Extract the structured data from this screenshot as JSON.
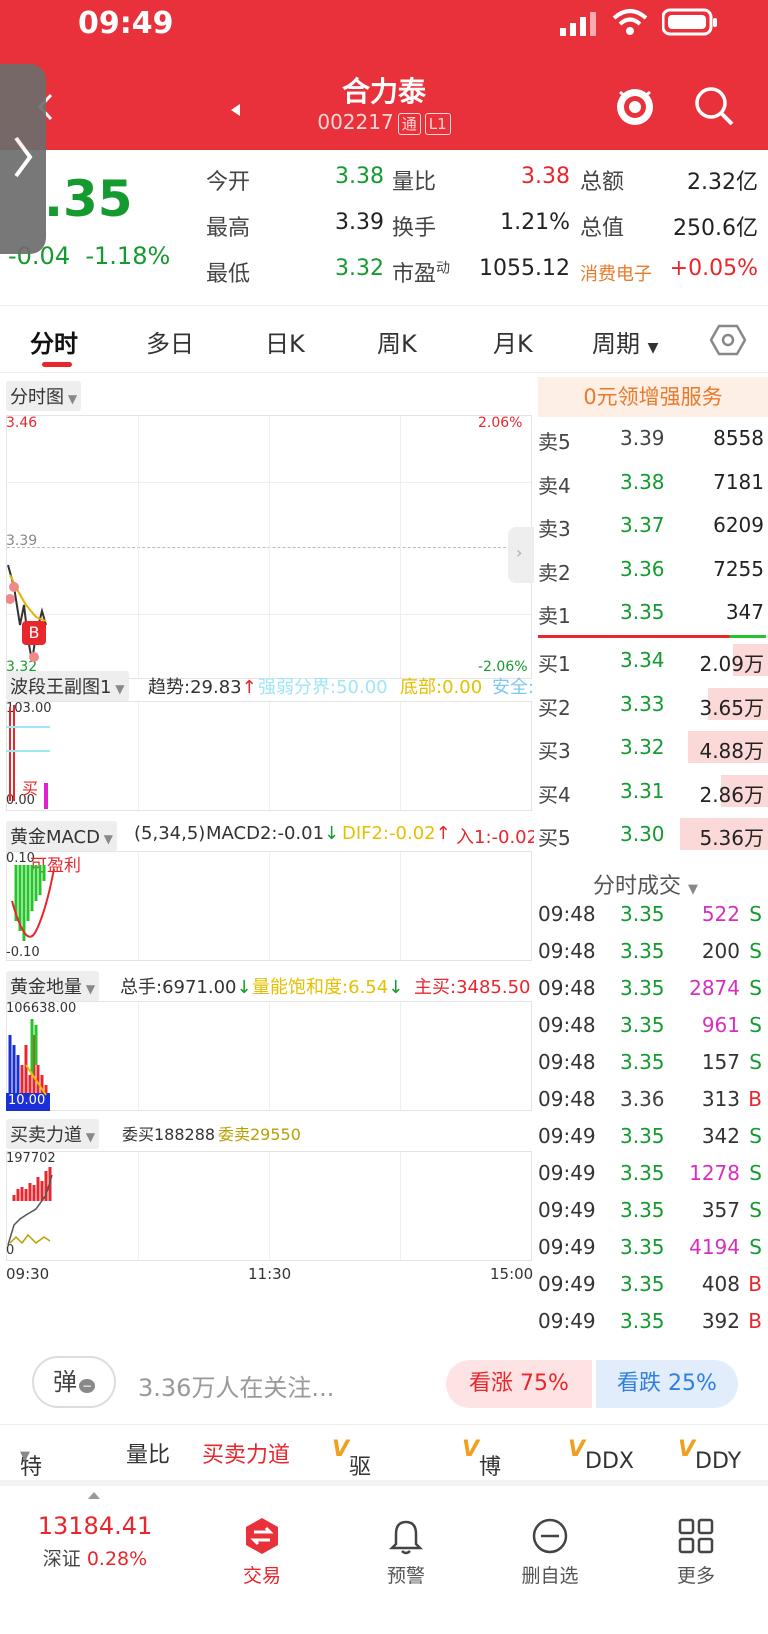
{
  "status": {
    "time": "09:49"
  },
  "header": {
    "name": "合力泰",
    "code": "002217",
    "tag1": "通",
    "tag2": "L1"
  },
  "quote": {
    "price": "3.35",
    "price_partial": ".35",
    "change": "-0.04",
    "change_pct": "-1.18%",
    "fields": [
      {
        "label": "今开",
        "value": "3.38"
      },
      {
        "label": "量比",
        "value": "3.38"
      },
      {
        "label": "总额",
        "value": "2.32亿"
      },
      {
        "label": "最高",
        "value": "3.39"
      },
      {
        "label": "换手",
        "value": "1.21%"
      },
      {
        "label": "总值",
        "value": "250.6亿"
      },
      {
        "label": "最低",
        "value": "3.32"
      },
      {
        "label": "市盈动",
        "value": "1055.12"
      },
      {
        "label": "消费电子",
        "value": "+0.05%"
      }
    ],
    "pe_label": "市盈",
    "pe_sup": "动"
  },
  "tabs": [
    "分时",
    "多日",
    "日K",
    "周K",
    "月K",
    "周期"
  ],
  "chart": {
    "pane1": {
      "label": "分时图",
      "top_price": "3.46",
      "top_pct": "2.06%",
      "mid_price": "3.39",
      "bot_price": "3.32",
      "bot_pct": "-2.06%",
      "b_marker": "B"
    },
    "pane2": {
      "label": "波段王副图1",
      "trend": "趋势:29.83",
      "divide": "强弱分界:50.00",
      "bottom": "底部:0.00",
      "safe": "安全:",
      "top": "103.00",
      "bot": "0.00",
      "buy": "买"
    },
    "pane3": {
      "label": "黄金MACD",
      "params": "(5,34,5)",
      "macd2": "MACD2:-0.01",
      "dif2": "DIF2:-0.02",
      "entry": "入1:-0.02",
      "top": "0.10",
      "profit": "可盈利",
      "bot": "-0.10"
    },
    "pane4": {
      "label": "黄金地量",
      "total": "总手:6971.00",
      "sat": "量能饱和度:6.54",
      "main": "主买:3485.50",
      "top": "106638.00",
      "bot": "10.00"
    },
    "pane5": {
      "label": "买卖力道",
      "bid": "委买188288",
      "ask": "委卖29550",
      "top": "197702",
      "bot": "0"
    },
    "times": [
      "09:30",
      "11:30",
      "15:00"
    ]
  },
  "orderbook": {
    "promo": "0元领增强服务",
    "asks": [
      {
        "label": "卖5",
        "price": "3.39",
        "vol": "8558"
      },
      {
        "label": "卖4",
        "price": "3.38",
        "vol": "7181"
      },
      {
        "label": "卖3",
        "price": "3.37",
        "vol": "6209"
      },
      {
        "label": "卖2",
        "price": "3.36",
        "vol": "7255"
      },
      {
        "label": "卖1",
        "price": "3.35",
        "vol": "347"
      }
    ],
    "bids": [
      {
        "label": "买1",
        "price": "3.34",
        "vol": "2.09万",
        "fill": 0.35
      },
      {
        "label": "买2",
        "price": "3.33",
        "vol": "3.65万",
        "fill": 0.6
      },
      {
        "label": "买3",
        "price": "3.32",
        "vol": "4.88万",
        "fill": 0.8
      },
      {
        "label": "买4",
        "price": "3.31",
        "vol": "2.86万",
        "fill": 0.47
      },
      {
        "label": "买5",
        "price": "3.30",
        "vol": "5.36万",
        "fill": 0.88
      }
    ]
  },
  "ticks": {
    "title": "分时成交",
    "rows": [
      {
        "time": "09:48",
        "price": "3.35",
        "vol": "522",
        "side": "S",
        "big": true
      },
      {
        "time": "09:48",
        "price": "3.35",
        "vol": "200",
        "side": "S",
        "big": false
      },
      {
        "time": "09:48",
        "price": "3.35",
        "vol": "2874",
        "side": "S",
        "big": true
      },
      {
        "time": "09:48",
        "price": "3.35",
        "vol": "961",
        "side": "S",
        "big": true
      },
      {
        "time": "09:48",
        "price": "3.35",
        "vol": "157",
        "side": "S",
        "big": false
      },
      {
        "time": "09:48",
        "price": "3.36",
        "vol": "313",
        "side": "B",
        "big": false
      },
      {
        "time": "09:49",
        "price": "3.35",
        "vol": "342",
        "side": "S",
        "big": false
      },
      {
        "time": "09:49",
        "price": "3.35",
        "vol": "1278",
        "side": "S",
        "big": true
      },
      {
        "time": "09:49",
        "price": "3.35",
        "vol": "357",
        "side": "S",
        "big": false
      },
      {
        "time": "09:49",
        "price": "3.35",
        "vol": "4194",
        "side": "S",
        "big": true
      },
      {
        "time": "09:49",
        "price": "3.35",
        "vol": "408",
        "side": "B",
        "big": false
      },
      {
        "time": "09:49",
        "price": "3.35",
        "vol": "392",
        "side": "B",
        "big": false
      }
    ]
  },
  "social": {
    "popup": "弹",
    "watchers": "3.36万人在关注...",
    "up": "看涨 75%",
    "down": "看跌 25%"
  },
  "features": {
    "special": "特色",
    "vol_ratio": "量比",
    "force": "买卖力道",
    "drive": "驱动力",
    "game": "博弈",
    "ddx": "DDX",
    "ddy": "DDY",
    "v": "V"
  },
  "nav": {
    "index_value": "13184.41",
    "index_name": "深证",
    "index_pct": "0.28%",
    "trade": "交易",
    "alert": "预警",
    "remove": "删自选",
    "more": "更多"
  }
}
